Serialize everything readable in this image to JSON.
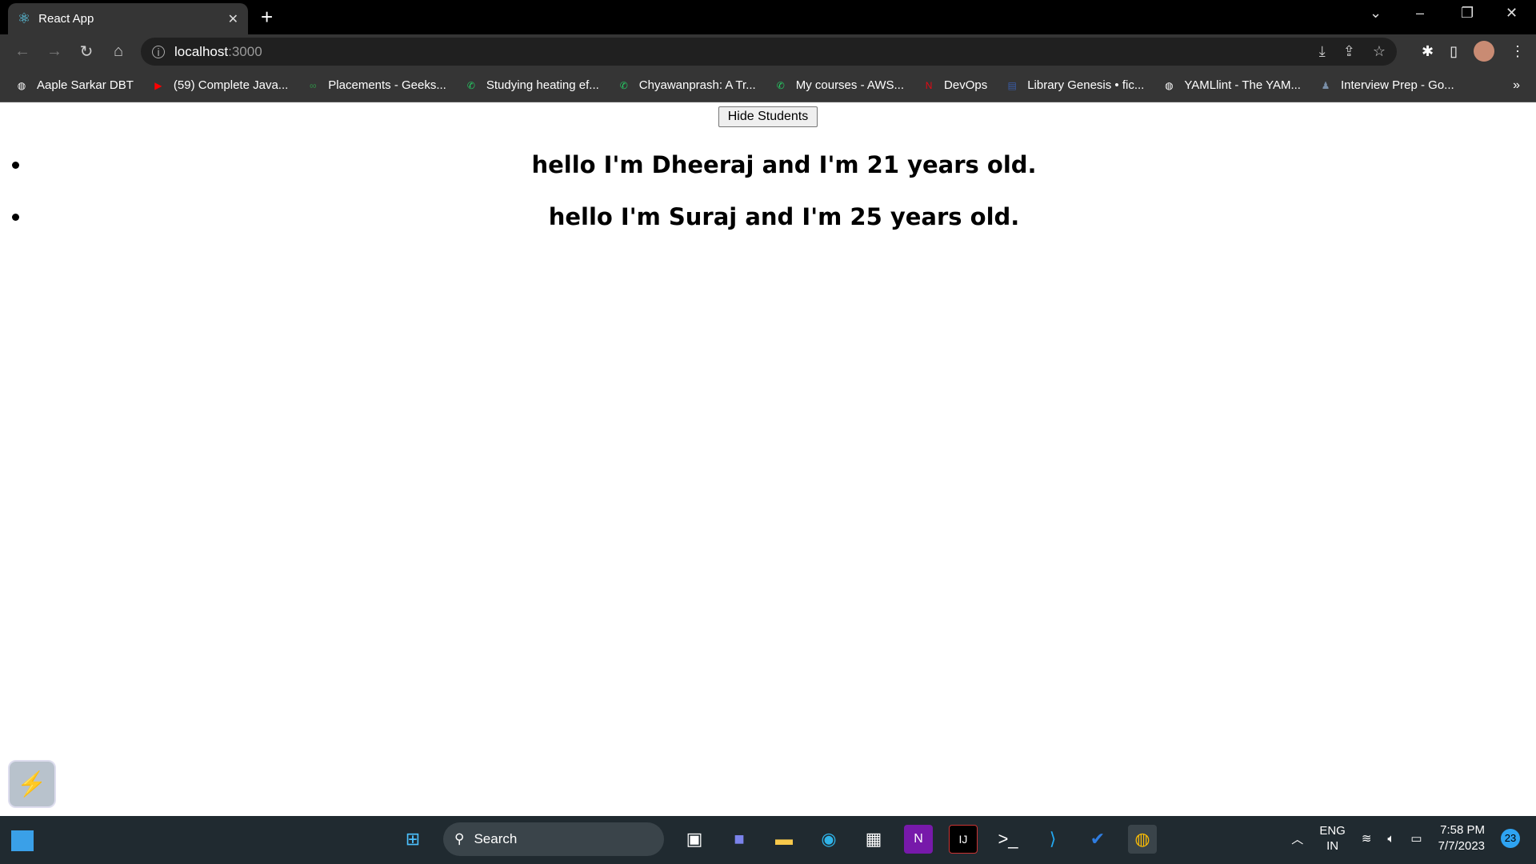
{
  "browser": {
    "tab": {
      "title": "React App",
      "favicon": "react-icon"
    },
    "url": {
      "host": "localhost",
      "port": ":3000"
    },
    "bookmarks": [
      {
        "label": "Aaple Sarkar DBT",
        "icon": "globe-icon",
        "color": "#ffffff"
      },
      {
        "label": "(59) Complete Java...",
        "icon": "youtube-icon",
        "color": "#ff0000"
      },
      {
        "label": "Placements - Geeks...",
        "icon": "geeksforgeeks-icon",
        "color": "#2f8d46"
      },
      {
        "label": "Studying heating ef...",
        "icon": "whatsapp-icon",
        "color": "#25d366"
      },
      {
        "label": "Chyawanprash: A Tr...",
        "icon": "whatsapp-icon",
        "color": "#25d366"
      },
      {
        "label": "My courses - AWS...",
        "icon": "whatsapp-icon",
        "color": "#25d366"
      },
      {
        "label": "DevOps",
        "icon": "netflix-icon",
        "color": "#e50914"
      },
      {
        "label": "Library Genesis • fic...",
        "icon": "libgen-icon",
        "color": "#3a5da8"
      },
      {
        "label": "YAMLlint - The YAM...",
        "icon": "globe-icon",
        "color": "#ffffff"
      },
      {
        "label": "Interview Prep - Go...",
        "icon": "person-icon",
        "color": "#7a8fa8"
      }
    ],
    "more": "»"
  },
  "page": {
    "button_label": "Hide Students",
    "students": [
      "hello I'm Dheeraj and I'm 21 years old.",
      "hello I'm Suraj and I'm 25 years old."
    ]
  },
  "taskbar": {
    "search_placeholder": "Search",
    "lang1": "ENG",
    "lang2": "IN",
    "time": "7:58 PM",
    "date": "7/7/2023",
    "notifications": "23"
  }
}
